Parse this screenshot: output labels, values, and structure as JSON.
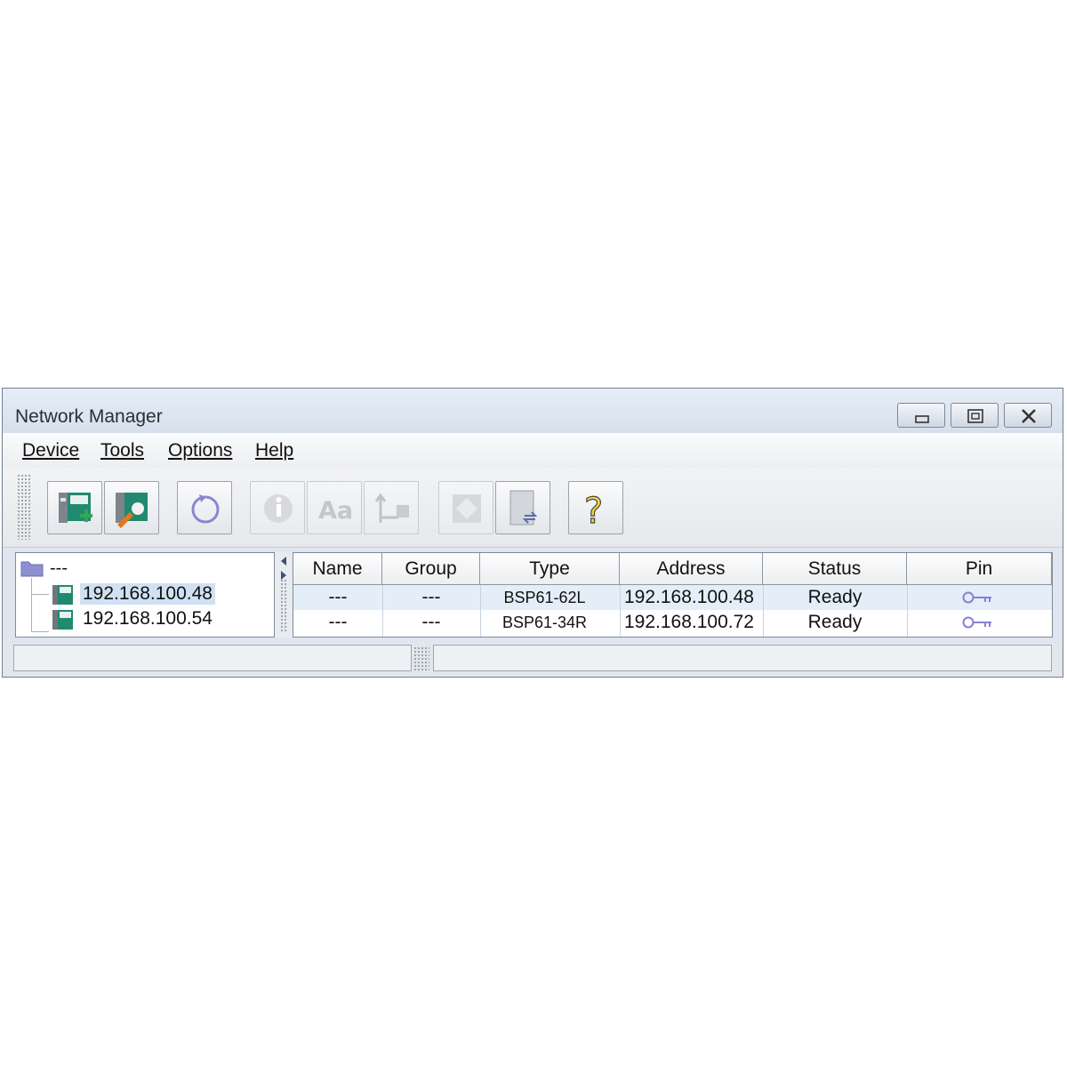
{
  "window": {
    "title": "Network Manager"
  },
  "menu": [
    {
      "label": "Device",
      "mnemonic": "D"
    },
    {
      "label": "Tools",
      "mnemonic": "T"
    },
    {
      "label": "Options",
      "mnemonic": "O"
    },
    {
      "label": "Help",
      "mnemonic": "H"
    }
  ],
  "toolbar": {
    "buttons": [
      {
        "icon": "add-device-icon",
        "enabled": true
      },
      {
        "icon": "edit-device-icon",
        "enabled": true
      },
      {
        "icon": "refresh-icon",
        "enabled": true
      },
      {
        "icon": "info-icon",
        "enabled": false
      },
      {
        "icon": "font-icon",
        "enabled": false
      },
      {
        "icon": "network-connection-icon",
        "enabled": false
      },
      {
        "icon": "card-icon",
        "enabled": false
      },
      {
        "icon": "device-transfer-icon",
        "enabled": true
      },
      {
        "icon": "help-icon",
        "enabled": true
      }
    ],
    "font_label": "Aa",
    "help_label": "?"
  },
  "tree": {
    "root_label": "---",
    "items": [
      {
        "label": "192.168.100.48",
        "selected": true
      },
      {
        "label": "192.168.100.54",
        "selected": false
      }
    ]
  },
  "table": {
    "columns": [
      "Name",
      "Group",
      "Type",
      "Address",
      "Status",
      "Pin"
    ],
    "rows": [
      {
        "name": "---",
        "group": "---",
        "type": "BSP61-62L",
        "address": "192.168.100.48",
        "status": "Ready",
        "pin": "key-icon",
        "selected": true
      },
      {
        "name": "---",
        "group": "---",
        "type": "BSP61-34R",
        "address": "192.168.100.72",
        "status": "Ready",
        "pin": "key-icon",
        "selected": false
      }
    ]
  },
  "colors": {
    "selection": "#cfe1f3",
    "row_selection": "#e3eef9",
    "device_icon": "#1f8a6f",
    "key_icon": "#8a7fd0"
  }
}
